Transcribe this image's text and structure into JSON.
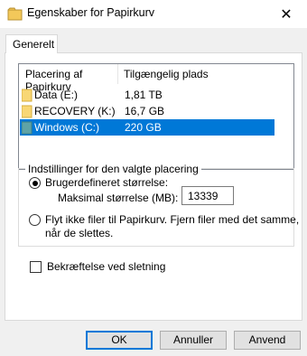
{
  "window": {
    "title": "Egenskaber for Papirkurv",
    "close_symbol": "✕"
  },
  "tabs": [
    {
      "label": "Generelt"
    }
  ],
  "list": {
    "headers": {
      "location": "Placering af Papirkurv",
      "available": "Tilgængelig plads"
    },
    "rows": [
      {
        "name": "Data (E:)",
        "size": "1,81 TB",
        "selected": false,
        "icon_color": "#f8d775"
      },
      {
        "name": "RECOVERY (K:)",
        "size": "16,7 GB",
        "selected": false,
        "icon_color": "#f8d775"
      },
      {
        "name": "Windows (C:)",
        "size": "220 GB",
        "selected": true,
        "icon_color": "#5fa3a6"
      }
    ]
  },
  "settings": {
    "group_label": "Indstillinger for den valgte placering",
    "custom_size_label": "Brugerdefineret størrelse:",
    "max_size_label": "Maksimal størrelse (MB):",
    "max_size_value": "13339",
    "no_recycle_line1": "Flyt ikke filer til Papirkurv. Fjern filer med det samme,",
    "no_recycle_line2": "når de slettes.",
    "confirm_delete_label": "Bekræftelse ved sletning",
    "custom_size_checked": true,
    "no_recycle_checked": false,
    "confirm_delete_checked": false
  },
  "buttons": {
    "ok": "OK",
    "cancel": "Annuller",
    "apply": "Anvend"
  },
  "colors": {
    "accent": "#0078d7",
    "selection": "#0078d7"
  }
}
